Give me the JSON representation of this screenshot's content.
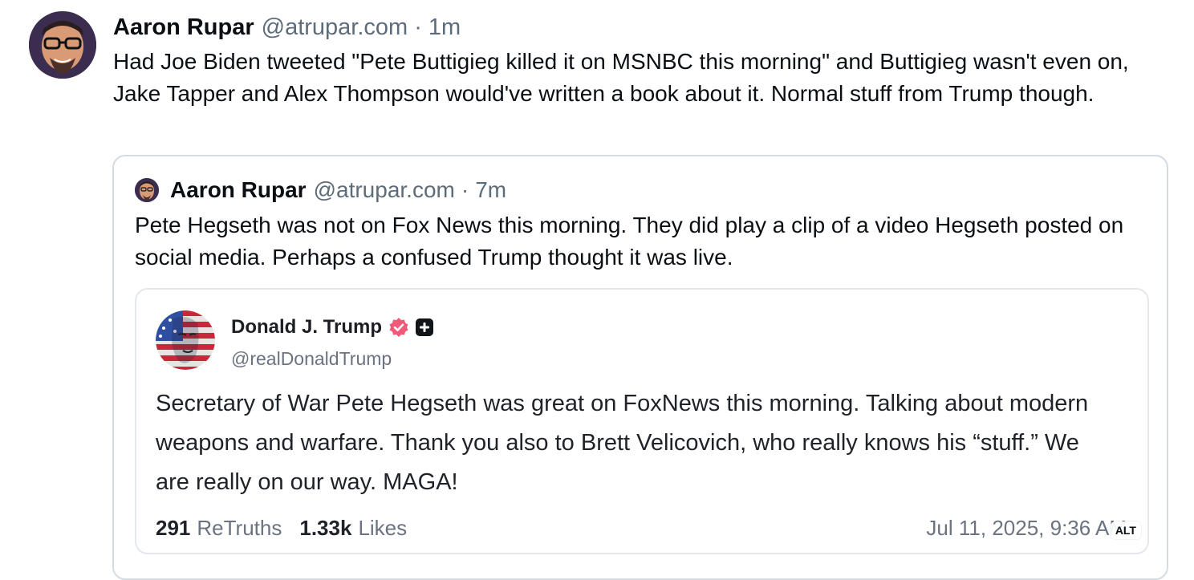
{
  "post": {
    "author": "Aaron Rupar",
    "handle": "@atrupar.com",
    "separator": "·",
    "time": "1m",
    "text": "Had Joe Biden tweeted \"Pete Buttigieg killed it on MSNBC this morning\" and Buttigieg wasn't even on, Jake Tapper and Alex Thompson would've written a book about it. Normal stuff from Trump though."
  },
  "quote": {
    "author": "Aaron Rupar",
    "handle": "@atrupar.com",
    "separator": "·",
    "time": "7m",
    "text": "Pete Hegseth was not on Fox News this morning. They did play a clip of a video Hegseth posted on social media. Perhaps a confused Trump thought it was live."
  },
  "embed": {
    "name": "Donald J. Trump",
    "handle": "@realDonaldTrump",
    "text": "Secretary of War Pete Hegseth was great on FoxNews this morning. Talking about modern weapons and warfare. Thank you also to Brett Velicovich, who really knows his “stuff.” We are really on our way. MAGA!",
    "retruths_count": "291",
    "retruths_label": "ReTruths",
    "likes_count": "1.33k",
    "likes_label": "Likes",
    "date": "Jul 11, 2025, 9:36 AM",
    "alt_badge": "ALT",
    "icons": {
      "verified": "verified-badge-icon",
      "plus": "plus-badge-icon"
    },
    "colors": {
      "verified_badge": "#f05a78"
    }
  }
}
